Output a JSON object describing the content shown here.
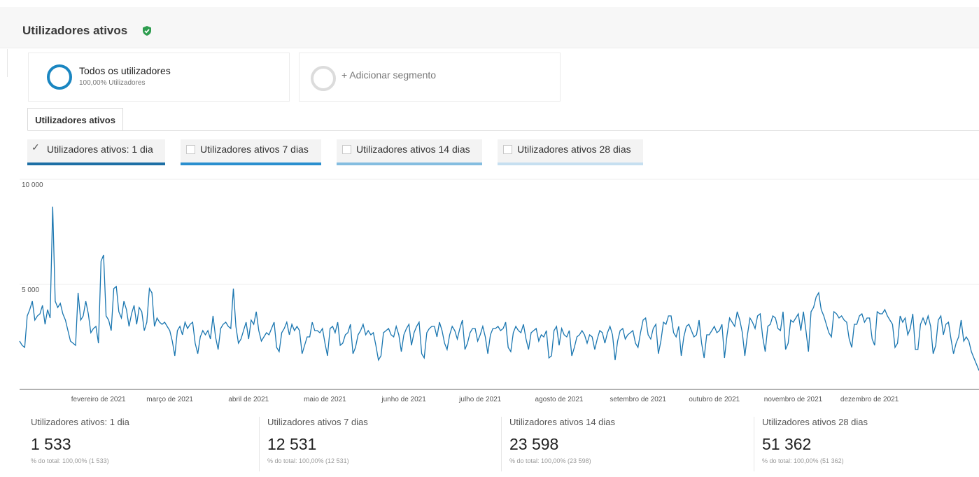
{
  "header": {
    "title": "Utilizadores ativos"
  },
  "segments": [
    {
      "name": "Todos os utilizadores",
      "subtitle": "100,00% Utilizadores"
    },
    {
      "name": "+ Adicionar segmento"
    }
  ],
  "tab": {
    "label": "Utilizadores ativos"
  },
  "metric_toggles": [
    {
      "label": "Utilizadores ativos: 1 dia",
      "checked": true,
      "color": "#1d6fa5"
    },
    {
      "label": "Utilizadores ativos 7 dias",
      "checked": false,
      "color": "#2a8fcf"
    },
    {
      "label": "Utilizadores ativos 14 dias",
      "checked": false,
      "color": "#84bde0"
    },
    {
      "label": "Utilizadores ativos 28 dias",
      "checked": false,
      "color": "#c6dff0"
    }
  ],
  "chart_data": {
    "type": "line",
    "series": [
      {
        "name": "Utilizadores ativos: 1 dia",
        "color": "#1a76b0",
        "x_start": "2021-01-01",
        "x_end": "2021-12-31",
        "values": [
          2300,
          2100,
          2000,
          3500,
          3800,
          4200,
          3300,
          3500,
          3600,
          4000,
          3100,
          3800,
          3400,
          8700,
          4200,
          3900,
          4100,
          3600,
          3300,
          2800,
          2300,
          2200,
          2100,
          4600,
          3300,
          3500,
          4200,
          3600,
          2700,
          2900,
          3000,
          2200,
          6100,
          6400,
          3500,
          3300,
          2800,
          4800,
          4900,
          3700,
          3400,
          4200,
          3800,
          3000,
          3600,
          4000,
          3100,
          3900,
          3700,
          2800,
          3200,
          4800,
          4600,
          3000,
          3400,
          3200,
          3100,
          3200,
          3000,
          2800,
          2300,
          1600,
          2800,
          3000,
          2600,
          3200,
          2900,
          3100,
          3200,
          2200,
          1700,
          2500,
          2800,
          2600,
          2800,
          2400,
          3500,
          2500,
          1900,
          2900,
          3100,
          3200,
          3000,
          2900,
          4800,
          3000,
          2200,
          2400,
          2800,
          3200,
          2400,
          3300,
          3100,
          3700,
          2800,
          2300,
          2500,
          2700,
          2600,
          2900,
          3200,
          2000,
          1800,
          2700,
          2900,
          3200,
          2600,
          3100,
          2800,
          3000,
          2800,
          1700,
          2100,
          2500,
          2500,
          3200,
          2800,
          2800,
          2700,
          2900,
          2200,
          1600,
          2900,
          3000,
          2700,
          3200,
          2100,
          2200,
          2600,
          2700,
          3100,
          1700,
          2000,
          2600,
          2800,
          3100,
          2600,
          2800,
          2600,
          2700,
          2100,
          1400,
          1600,
          2700,
          2800,
          2900,
          2600,
          2500,
          3000,
          2600,
          1800,
          2600,
          2900,
          3100,
          2100,
          2700,
          3000,
          3200,
          1700,
          1500,
          2700,
          2900,
          3000,
          3000,
          2500,
          3200,
          2800,
          2200,
          1900,
          2600,
          3000,
          2800,
          2400,
          2900,
          3300,
          1900,
          2200,
          2700,
          2900,
          2900,
          2300,
          2600,
          3000,
          2500,
          1700,
          2600,
          2900,
          2900,
          3000,
          2800,
          2900,
          3200,
          2000,
          1800,
          2700,
          3000,
          2800,
          2700,
          3100,
          2400,
          1900,
          2700,
          2800,
          2900,
          2300,
          2600,
          2500,
          2800,
          1500,
          1600,
          2800,
          3000,
          2100,
          2900,
          2600,
          2500,
          2800,
          1600,
          2000,
          2500,
          2600,
          2800,
          2600,
          2200,
          2600,
          2500,
          1900,
          2400,
          2800,
          2700,
          2200,
          2700,
          3000,
          2600,
          1400,
          2300,
          2800,
          2900,
          2400,
          2600,
          2700,
          2800,
          2200,
          2000,
          2700,
          3300,
          3400,
          2600,
          2400,
          2900,
          3100,
          1700,
          2300,
          3200,
          3100,
          3500,
          3500,
          2700,
          2500,
          3000,
          1600,
          2500,
          3000,
          3100,
          2800,
          2500,
          2600,
          3300,
          2200,
          1500,
          2600,
          2600,
          2800,
          3000,
          2700,
          2800,
          3100,
          1500,
          2600,
          3400,
          3200,
          3000,
          3700,
          3300,
          2700,
          1600,
          2600,
          3400,
          3200,
          2900,
          3500,
          3600,
          2500,
          1800,
          3000,
          3100,
          3500,
          3400,
          2900,
          2800,
          3700,
          1900,
          2200,
          3300,
          3200,
          3400,
          3600,
          2800,
          3700,
          2800,
          1800,
          3700,
          3900,
          4400,
          4600,
          3800,
          3500,
          3100,
          2700,
          2500,
          3700,
          3600,
          3400,
          3500,
          3300,
          3200,
          2400,
          2000,
          3100,
          3100,
          3500,
          3600,
          3200,
          3400,
          3400,
          2400,
          2100,
          3700,
          3600,
          3600,
          3800,
          3500,
          3300,
          3100,
          2000,
          2200,
          3500,
          3200,
          3400,
          2600,
          2900,
          3600,
          1900,
          1900,
          3100,
          3400,
          3100,
          3500,
          3000,
          1700,
          2100,
          3300,
          3500,
          2600,
          3100,
          3200,
          2400,
          1700,
          2200,
          2500,
          3300,
          2300,
          2500,
          2300,
          1800,
          1500,
          1200,
          900
        ]
      }
    ],
    "ylim": [
      0,
      10000
    ],
    "y_ticks": [
      "10 000",
      "5 000"
    ],
    "x_tick_labels": [
      "fevereiro de 2021",
      "março de 2021",
      "abril de 2021",
      "maio de 2021",
      "junho de 2021",
      "julho de 2021",
      "agosto de 2021",
      "setembro de 2021",
      "outubro de 2021",
      "novembro de 2021",
      "dezembro de 2021"
    ],
    "grid": true
  },
  "summary": [
    {
      "label": "Utilizadores ativos: 1 dia",
      "value": "1 533",
      "sub": "% do total: 100,00% (1 533)"
    },
    {
      "label": "Utilizadores ativos 7 dias",
      "value": "12 531",
      "sub": "% do total: 100,00% (12 531)"
    },
    {
      "label": "Utilizadores ativos 14 dias",
      "value": "23 598",
      "sub": "% do total: 100,00% (23 598)"
    },
    {
      "label": "Utilizadores ativos 28 dias",
      "value": "51 362",
      "sub": "% do total: 100,00% (51 362)"
    }
  ]
}
